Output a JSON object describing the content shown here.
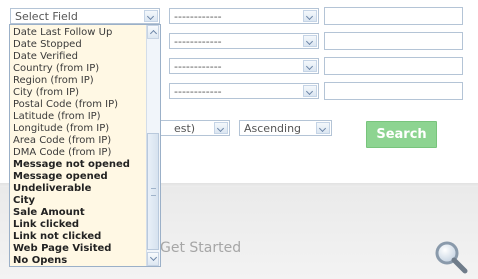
{
  "filter": {
    "field_select_value": "Select Field",
    "operator_placeholder": "------------",
    "row2_operator": "------------",
    "row3_operator": "------------",
    "row4_operator": "------------"
  },
  "sort": {
    "field_partial": "est)",
    "direction": "Ascending"
  },
  "search_button": "Search",
  "get_started_text": "Get Started",
  "field_options": [
    {
      "label": "Date Last Follow Up",
      "bold": false
    },
    {
      "label": "Date Stopped",
      "bold": false
    },
    {
      "label": "Date Verified",
      "bold": false
    },
    {
      "label": "Country (from IP)",
      "bold": false
    },
    {
      "label": "Region (from IP)",
      "bold": false
    },
    {
      "label": "City (from IP)",
      "bold": false
    },
    {
      "label": "Postal Code (from IP)",
      "bold": false
    },
    {
      "label": "Latitude (from IP)",
      "bold": false
    },
    {
      "label": "Longitude (from IP)",
      "bold": false
    },
    {
      "label": "Area Code (from IP)",
      "bold": false
    },
    {
      "label": "DMA Code (from IP)",
      "bold": false
    },
    {
      "label": "Message not opened",
      "bold": true
    },
    {
      "label": "Message opened",
      "bold": true
    },
    {
      "label": "Undeliverable",
      "bold": true
    },
    {
      "label": "City",
      "bold": true
    },
    {
      "label": "Sale Amount",
      "bold": true
    },
    {
      "label": "Link clicked",
      "bold": true
    },
    {
      "label": "Link not clicked",
      "bold": true
    },
    {
      "label": "Web Page Visited",
      "bold": true
    },
    {
      "label": "No Opens",
      "bold": true
    }
  ],
  "colors": {
    "search_button_bg": "#8dd491",
    "dropdown_bg": "#fff8e4",
    "border": "#b4c4d6"
  },
  "icons": {
    "magnifier": "magnifier-icon"
  }
}
